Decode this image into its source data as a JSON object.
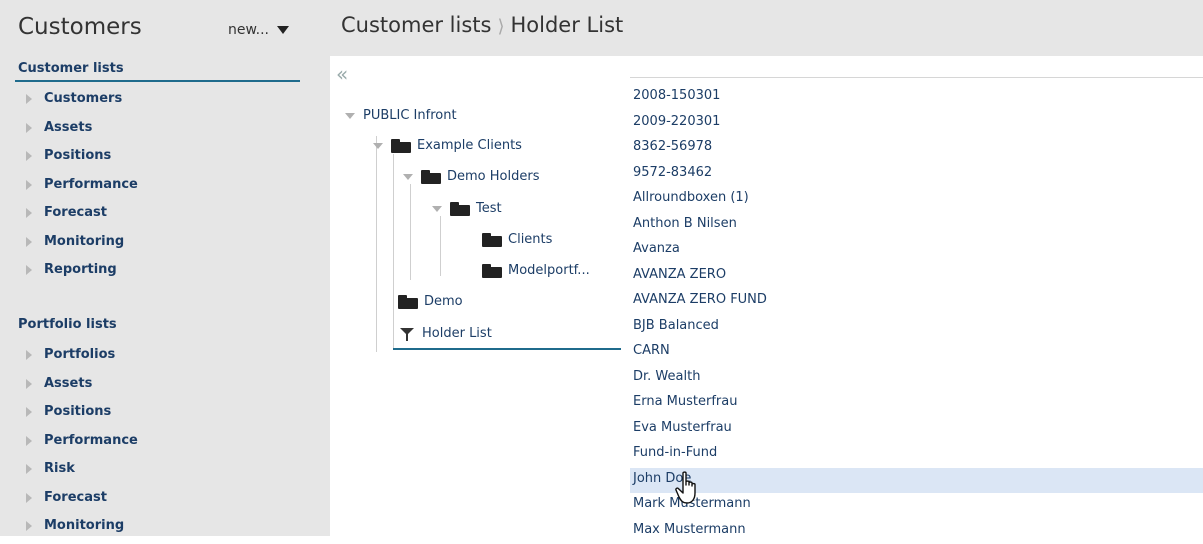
{
  "sidebar": {
    "title": "Customers",
    "new_label": "new...",
    "customer_lists": {
      "title": "Customer lists",
      "items": [
        "Customers",
        "Assets",
        "Positions",
        "Performance",
        "Forecast",
        "Monitoring",
        "Reporting"
      ]
    },
    "portfolio_lists": {
      "title": "Portfolio lists",
      "items": [
        "Portfolios",
        "Assets",
        "Positions",
        "Performance",
        "Risk",
        "Forecast",
        "Monitoring"
      ]
    }
  },
  "breadcrumb": {
    "parent": "Customer lists",
    "current": "Holder List"
  },
  "tree": {
    "collapse_icon": "«",
    "root": "PUBLIC Infront",
    "example_clients": "Example Clients",
    "demo_holders": "Demo Holders",
    "test": "Test",
    "clients": "Clients",
    "modelportf": "Modelportf...",
    "demo": "Demo",
    "holder_list": "Holder List"
  },
  "holders": {
    "search_value": "",
    "rows": [
      "2008-150301",
      "2009-220301",
      "8362-56978",
      "9572-83462",
      "Allroundboxen (1)",
      "Anthon B Nilsen",
      "Avanza",
      "AVANZA ZERO",
      "AVANZA ZERO FUND",
      "BJB Balanced",
      "CARN",
      "Dr. Wealth",
      "Erna Musterfrau",
      "Eva Musterfrau",
      "Fund-in-Fund",
      "John Doe",
      "Mark Mustermann",
      "Max Mustermann"
    ],
    "highlighted_index": 15
  },
  "colors": {
    "accent": "#1f6b8c",
    "highlight": "#dbe6f5",
    "panel": "#e6e6e6",
    "text": "#1c3d66"
  }
}
